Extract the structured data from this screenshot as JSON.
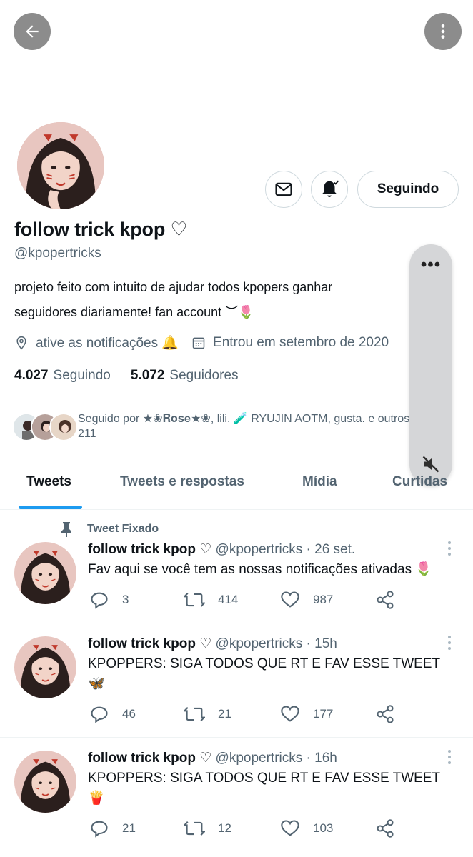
{
  "header": {
    "back_icon": "arrow-left-icon",
    "more_icon": "more-vertical-icon"
  },
  "profile": {
    "name": "follow trick kpop ♡",
    "handle": "@kpopertricks",
    "bio_line1": "projeto feito com intuito de ajudar todos kpopers ganhar",
    "bio_line2": "seguidores diariamente! fan account ︶🌷",
    "location": "ative as notificações 🔔",
    "joined": "Entrou em setembro de 2020",
    "following_count": "4.027",
    "following_label": "Seguindo",
    "followers_count": "5.072",
    "followers_label": "Seguidores",
    "followed_by": "Seguido por ★❀𝐑𝐨𝐬𝐞★❀, lili. 🧪 RYUJIN AOTM, gusta. e outros 211",
    "follow_button": "Seguindo"
  },
  "overlay": {
    "dots": "•••"
  },
  "tabs": [
    {
      "label": "Tweets"
    },
    {
      "label": "Tweets e respostas"
    },
    {
      "label": "Mídia"
    },
    {
      "label": "Curtidas"
    }
  ],
  "tweets": [
    {
      "pinned_label": "Tweet Fixado",
      "name": "follow trick kpop ♡",
      "handle_time": "@kpopertricks · 26 set.",
      "text": "Fav aqui se você tem as nossas notificações ativadas 🌷",
      "replies": "3",
      "retweets": "414",
      "likes": "987"
    },
    {
      "name": "follow trick kpop ♡",
      "handle_time": "@kpopertricks · 15h",
      "text": "KPOPPERS: SIGA TODOS QUE RT E FAV ESSE TWEET 🦋",
      "replies": "46",
      "retweets": "21",
      "likes": "177"
    },
    {
      "name": "follow trick kpop ♡",
      "handle_time": "@kpopertricks · 16h",
      "text": "KPOPPERS: SIGA TODOS QUE RT E FAV ESSE TWEET 🍟",
      "replies": "21",
      "retweets": "12",
      "likes": "103"
    }
  ],
  "colors": {
    "accent": "#1d9bf0",
    "secondary_text": "#536471",
    "border": "#cfd9de"
  }
}
